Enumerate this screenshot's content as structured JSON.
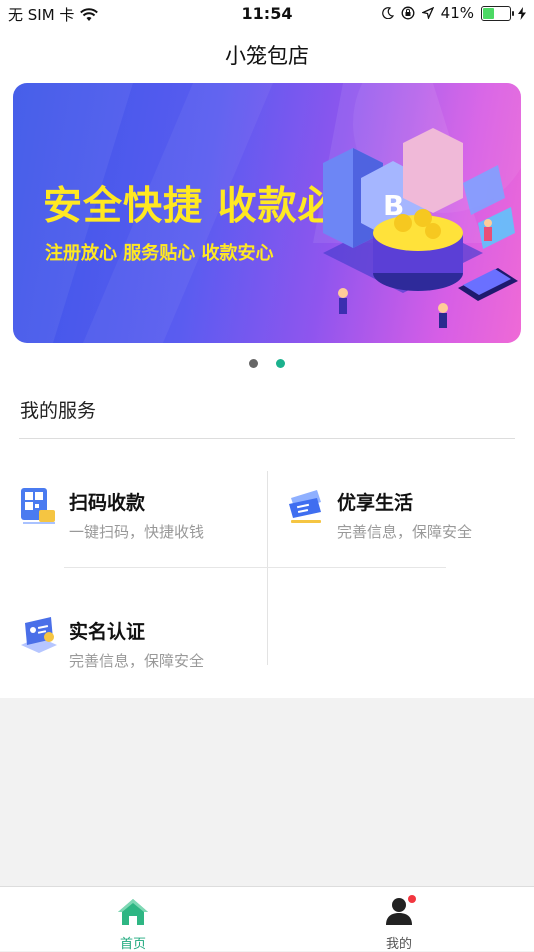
{
  "status_bar": {
    "carrier": "无 SIM 卡",
    "time": "11:54",
    "battery": "41%",
    "battery_level": 0.41
  },
  "nav": {
    "title": "小笼包店"
  },
  "banner": {
    "headline": "安全快捷 收款必备",
    "subline": "注册放心 服务贴心 收款安心",
    "page_count": 2,
    "active_page": 2
  },
  "services": {
    "section_title": "我的服务",
    "items": [
      {
        "title": "扫码收款",
        "desc": "一键扫码，快捷收钱",
        "icon": "qr-scan-icon"
      },
      {
        "title": "优享生活",
        "desc": "完善信息，保障安全",
        "icon": "ticket-icon"
      },
      {
        "title": "实名认证",
        "desc": "完善信息，保障安全",
        "icon": "id-card-icon"
      }
    ]
  },
  "tabs": [
    {
      "label": "首页",
      "icon": "home-icon",
      "active": true
    },
    {
      "label": "我的",
      "icon": "user-icon",
      "active": false,
      "badge": true
    }
  ],
  "colors": {
    "accent": "#1fa97e",
    "banner_text": "#ffe822",
    "badge": "#f2363f"
  }
}
